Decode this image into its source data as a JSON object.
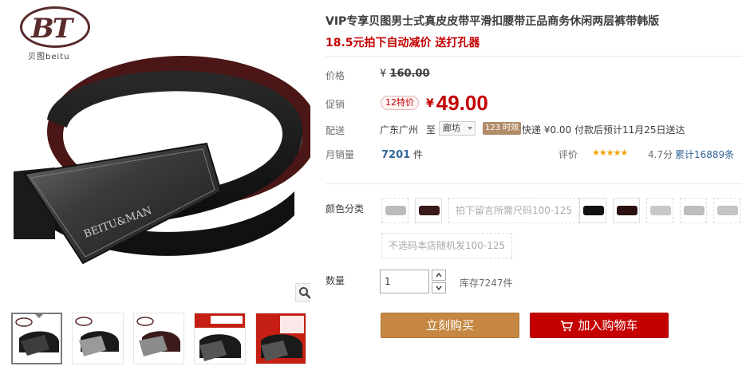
{
  "brand": {
    "mark": "BT",
    "text": "贝图beitu"
  },
  "product": {
    "title": "VIP专享贝图男士式真皮皮带平滑扣腰带正品商务休闲两层裤带韩版",
    "subtitle": "18.5元拍下自动减价 送打孔器",
    "buckle_text": "BEITU&MAN"
  },
  "price": {
    "label": "价格",
    "currency": "¥",
    "original": "160.00"
  },
  "promo": {
    "label": "促销",
    "badge": "12特价",
    "currency": "¥",
    "price": "49.00"
  },
  "shipping": {
    "label": "配送",
    "from": "广东广州",
    "to_label": "至",
    "to_value": "廊坊",
    "badge": "123 时效",
    "text": "快递 ¥0.00 付款后预计11月25日送达"
  },
  "sales": {
    "label": "月销量",
    "count": "7201",
    "unit": "件"
  },
  "rating": {
    "label": "评价",
    "stars": "★★★★★",
    "score": "4.7分",
    "reviews": "累计16889条"
  },
  "options": {
    "label": "颜色分类",
    "text_swatch_1": "拍下留言所需尺码100-125",
    "text_swatch_2": "不选码本店随机发100-125"
  },
  "quantity": {
    "label": "数量",
    "value": "1",
    "stock": "库存7247件"
  },
  "actions": {
    "buy": "立刻购买",
    "cart": "加入购物车"
  },
  "icons": [
    "magnifier-icon",
    "cart-icon",
    "chevron-up-icon",
    "chevron-down-icon"
  ],
  "colors": {
    "price_red": "#c40000",
    "buy_orange": "#c58742",
    "star": "#f4a000"
  }
}
